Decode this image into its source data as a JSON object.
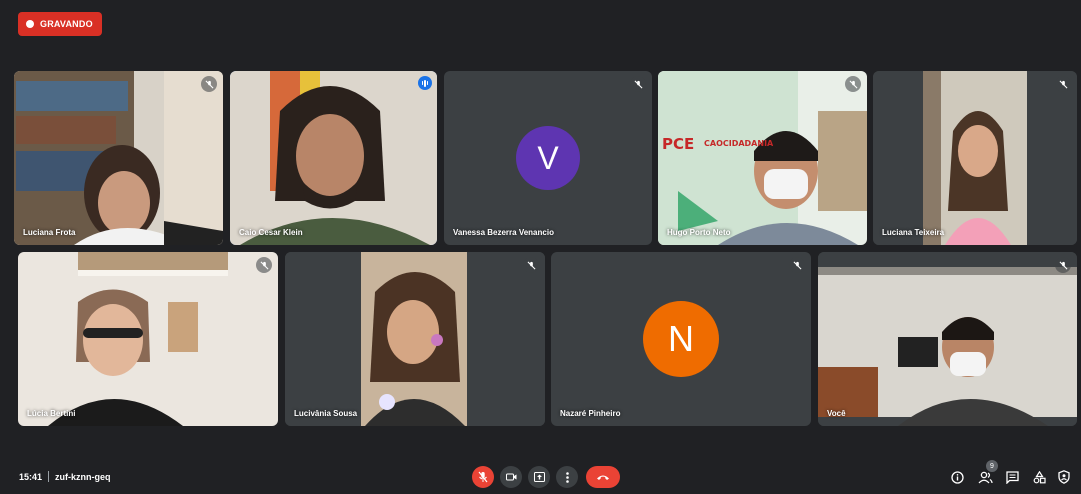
{
  "recording": {
    "label": "GRAVANDO"
  },
  "participants": [
    {
      "name": "Luciana Frota",
      "mic": "muted"
    },
    {
      "name": "Caio Cesar Klein",
      "mic": "speaking"
    },
    {
      "name": "Vanessa Bezerra Venancio",
      "mic": "muted",
      "avatar_letter": "V",
      "avatar_color": "#5e35b1"
    },
    {
      "name": "Hugo Porto Neto",
      "mic": "muted",
      "wall_text": "PCE",
      "wall_text2": "CAOCIDADANIA"
    },
    {
      "name": "Luciana Teixeira",
      "mic": "muted"
    },
    {
      "name": "Lúcia Bertini",
      "mic": "muted"
    },
    {
      "name": "Lucivânia Sousa",
      "mic": "muted"
    },
    {
      "name": "Nazaré Pinheiro",
      "mic": "muted",
      "avatar_letter": "N",
      "avatar_color": "#ef6c00"
    },
    {
      "name": "Você",
      "mic": "muted"
    }
  ],
  "footer": {
    "time": "15:41",
    "meeting_code": "zuf-kznn-geq",
    "participant_count": "9"
  },
  "colors": {
    "recording": "#d93025",
    "hangup": "#ea4335",
    "active_speaker": "#8ab4f8",
    "tile_bg": "#3c4043",
    "page_bg": "#202124"
  },
  "icons": [
    "mic-off-icon",
    "camera-icon",
    "present-icon",
    "more-options-icon",
    "hang-up-icon",
    "info-icon",
    "people-icon",
    "chat-icon",
    "activities-icon",
    "host-controls-icon"
  ]
}
